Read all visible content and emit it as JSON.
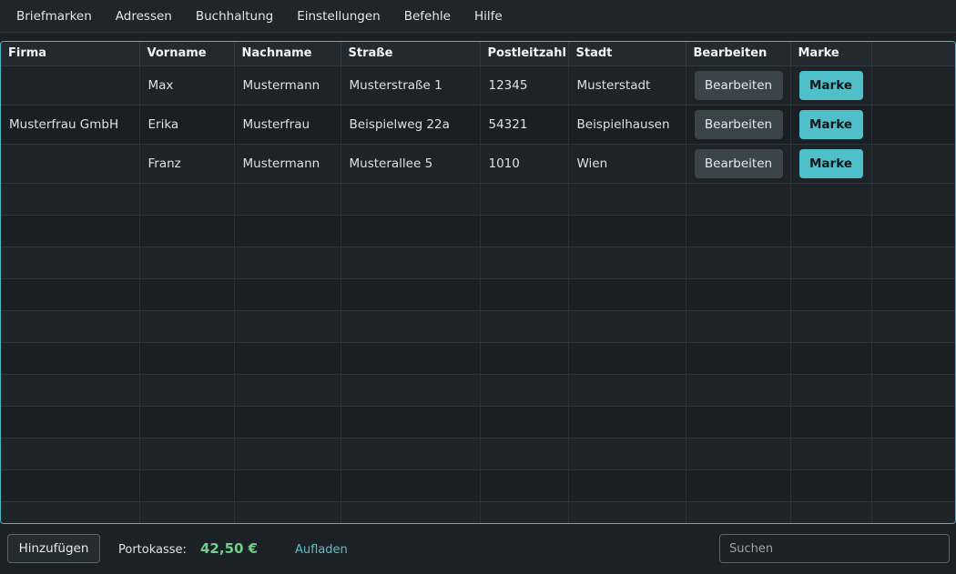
{
  "menu": [
    "Briefmarken",
    "Adressen",
    "Buchhaltung",
    "Einstellungen",
    "Befehle",
    "Hilfe"
  ],
  "table": {
    "headers": [
      "Firma",
      "Vorname",
      "Nachname",
      "Straße",
      "Postleitzahl",
      "Stadt",
      "Bearbeiten",
      "Marke"
    ],
    "rows": [
      {
        "firma": "",
        "vorname": "Max",
        "nachname": "Mustermann",
        "strasse": "Musterstraße 1",
        "plz": "12345",
        "stadt": "Musterstadt"
      },
      {
        "firma": "Musterfrau GmbH",
        "vorname": "Erika",
        "nachname": "Musterfrau",
        "strasse": "Beispielweg 22a",
        "plz": "54321",
        "stadt": "Beispielhausen"
      },
      {
        "firma": "",
        "vorname": "Franz",
        "nachname": "Mustermann",
        "strasse": "Musterallee 5",
        "plz": "1010",
        "stadt": "Wien"
      }
    ],
    "edit_label": "Bearbeiten",
    "mark_label": "Marke"
  },
  "footer": {
    "add_label": "Hinzufügen",
    "porto_label": "Portokasse:",
    "porto_value": "42,50 €",
    "topup_label": "Aufladen",
    "search_placeholder": "Suchen",
    "search_value": ""
  }
}
